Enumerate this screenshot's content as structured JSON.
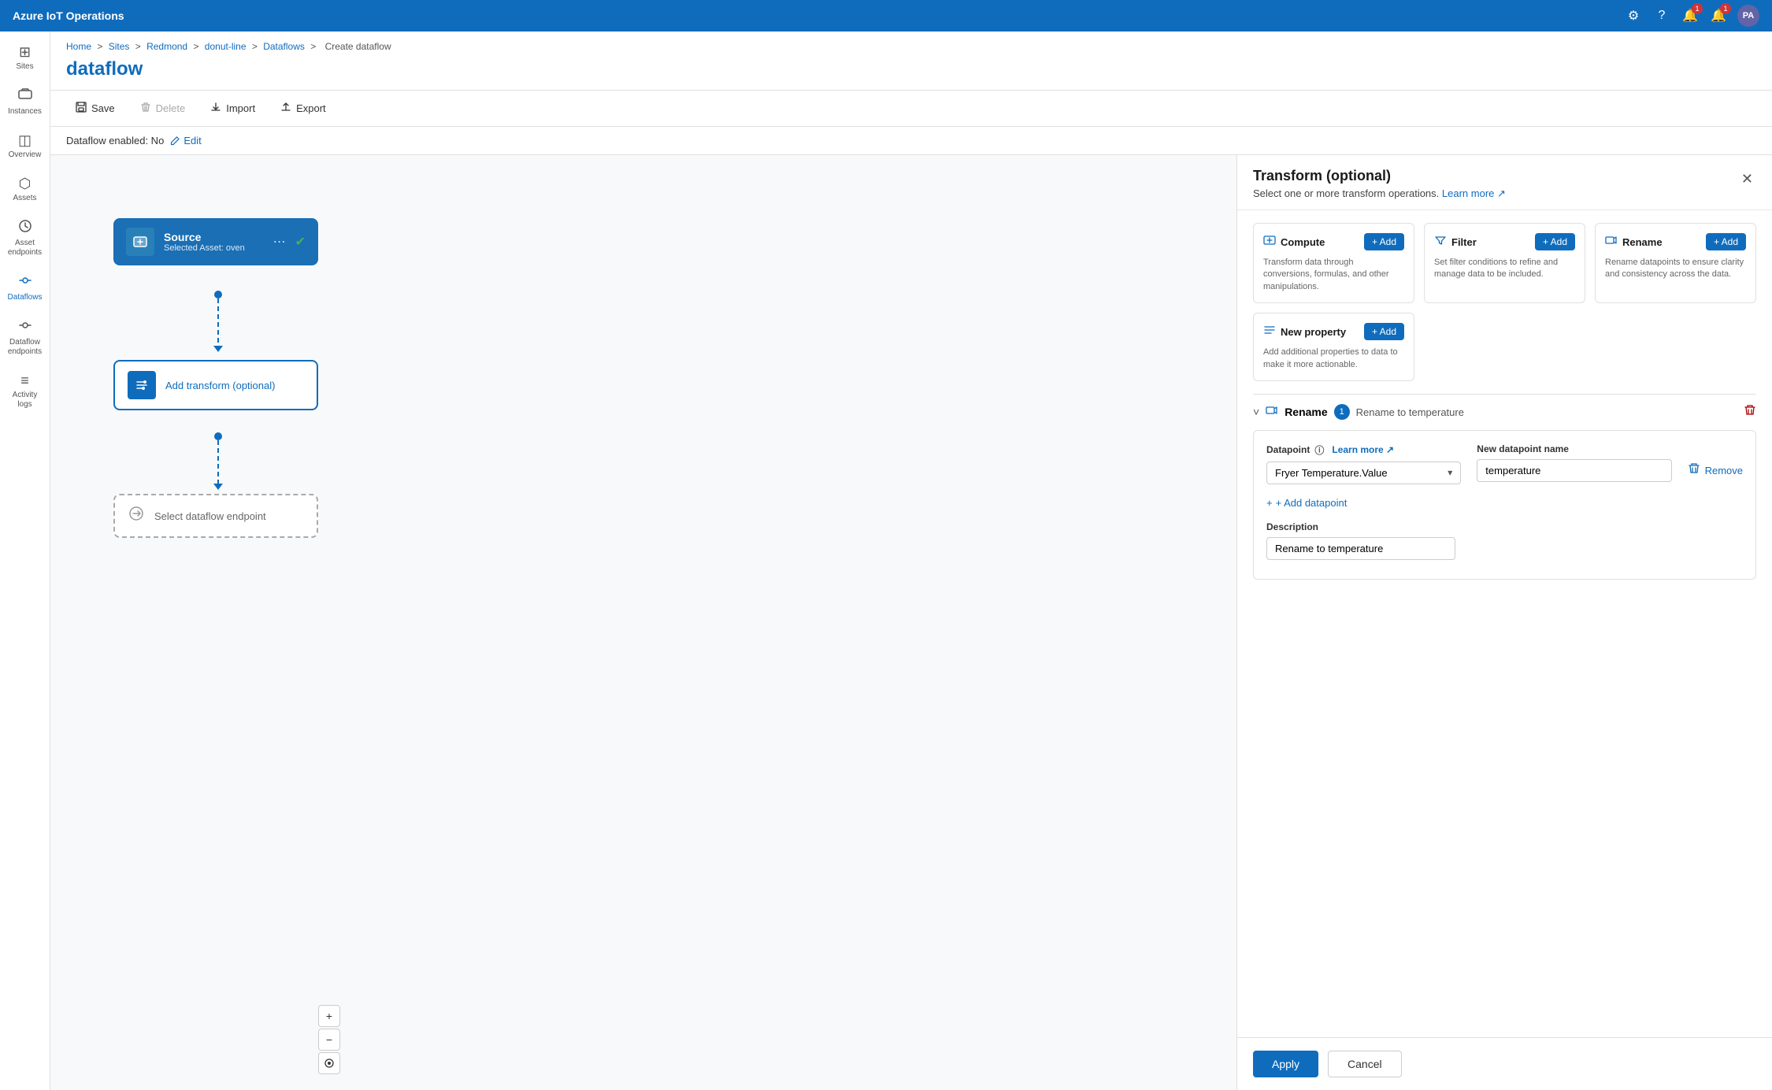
{
  "app": {
    "title": "Azure IoT Operations"
  },
  "nav_icons": {
    "settings": "⚙",
    "help": "?",
    "notifications1": "🔔",
    "notifications1_badge": "1",
    "notifications2": "🔔",
    "notifications2_badge": "1",
    "avatar": "PA"
  },
  "sidebar": {
    "items": [
      {
        "id": "sites",
        "icon": "⊞",
        "label": "Sites"
      },
      {
        "id": "instances",
        "icon": "☁",
        "label": "Instances"
      },
      {
        "id": "overview",
        "icon": "◫",
        "label": "Overview"
      },
      {
        "id": "assets",
        "icon": "⬡",
        "label": "Assets"
      },
      {
        "id": "asset-endpoints",
        "icon": "⬡",
        "label": "Asset endpoints"
      },
      {
        "id": "dataflows",
        "icon": "⇄",
        "label": "Dataflows",
        "active": true
      },
      {
        "id": "dataflow-endpoints",
        "icon": "⇄",
        "label": "Dataflow endpoints"
      },
      {
        "id": "activity-logs",
        "icon": "≡",
        "label": "Activity logs"
      }
    ]
  },
  "breadcrumb": {
    "items": [
      "Home",
      "Sites",
      "Redmond",
      "donut-line",
      "Dataflows",
      "Create dataflow"
    ]
  },
  "page": {
    "title": "dataflow"
  },
  "toolbar": {
    "save": "Save",
    "delete": "Delete",
    "import": "Import",
    "export": "Export"
  },
  "status": {
    "text": "Dataflow enabled: No",
    "edit": "Edit"
  },
  "flow": {
    "source_node": {
      "title": "Source",
      "subtitle": "Selected Asset: oven"
    },
    "transform_node": {
      "title": "Add transform (optional)"
    },
    "endpoint_node": {
      "title": "Select dataflow endpoint"
    }
  },
  "canvas_controls": {
    "zoom_in": "+",
    "zoom_out": "−",
    "fit": "⊙"
  },
  "panel": {
    "title": "Transform (optional)",
    "subtitle": "Select one or more transform operations.",
    "learn_more": "Learn more",
    "close_icon": "✕",
    "transform_cards": [
      {
        "id": "compute",
        "icon": "⊞",
        "title": "Compute",
        "description": "Transform data through conversions, formulas, and other manipulations.",
        "add_label": "+ Add"
      },
      {
        "id": "filter",
        "icon": "⊟",
        "title": "Filter",
        "description": "Set filter conditions to refine and manage data to be included.",
        "add_label": "+ Add"
      },
      {
        "id": "rename",
        "icon": "⊞",
        "title": "Rename",
        "description": "Rename datapoints to ensure clarity and consistency across the data.",
        "add_label": "+ Add"
      },
      {
        "id": "new-property",
        "icon": "≡",
        "title": "New property",
        "description": "Add additional properties to data to make it more actionable.",
        "add_label": "+ Add"
      }
    ],
    "rename_section": {
      "chevron": "˅",
      "icon": "⊞",
      "title": "Rename",
      "badge": "1",
      "subtitle": "Rename to temperature",
      "delete_icon": "🗑",
      "datapoint_label": "Datapoint",
      "learn_more": "Learn more",
      "datapoint_value": "Fryer Temperature.Value",
      "new_name_label": "New datapoint name",
      "new_name_value": "temperature",
      "remove_label": "Remove",
      "add_datapoint": "+ Add datapoint",
      "description_label": "Description",
      "description_value": "Rename to temperature"
    },
    "footer": {
      "apply": "Apply",
      "cancel": "Cancel"
    }
  }
}
